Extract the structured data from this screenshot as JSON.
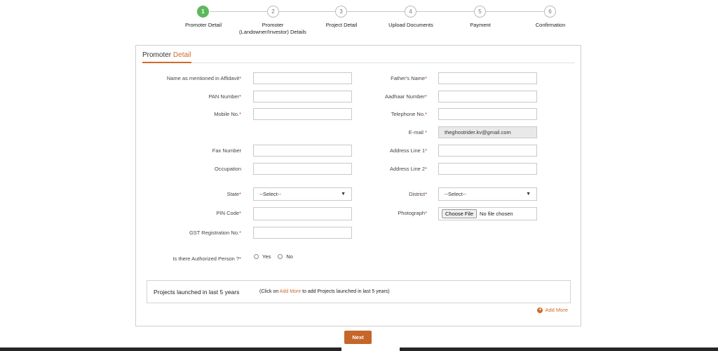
{
  "stepper": {
    "steps": [
      {
        "number": "1",
        "label": "Promoter Detail"
      },
      {
        "number": "2",
        "label": "Promoter",
        "label2": "(Landowner/Investor) Details"
      },
      {
        "number": "3",
        "label": "Project Detail"
      },
      {
        "number": "4",
        "label": "Upload Documents"
      },
      {
        "number": "5",
        "label": "Payment"
      },
      {
        "number": "6",
        "label": "Confirmation"
      }
    ]
  },
  "form": {
    "title_main": "Promoter",
    "title_accent": "Detail",
    "required_mark": "*",
    "fields": {
      "name_affidavit": {
        "label": "Name as mentioned in Affidavit",
        "value": ""
      },
      "fathers_name": {
        "label": "Father's Name",
        "value": ""
      },
      "pan": {
        "label": "PAN Number",
        "value": ""
      },
      "aadhaar": {
        "label": "Aadhaar Number",
        "value": ""
      },
      "mobile": {
        "label": "Mobile No.",
        "value": ""
      },
      "telephone": {
        "label": "Telephone No.",
        "value": ""
      },
      "email": {
        "label": "E-mail",
        "value": "theghostrider.kv@gmail.com"
      },
      "fax": {
        "label": "Fax Number",
        "value": ""
      },
      "address1": {
        "label": "Address Line 1",
        "value": ""
      },
      "occupation": {
        "label": "Occupation",
        "value": ""
      },
      "address2": {
        "label": "Address Line 2",
        "value": ""
      },
      "state": {
        "label": "State",
        "value": "--Select--"
      },
      "district": {
        "label": "District",
        "value": "--Select--"
      },
      "pin": {
        "label": "PIN Code",
        "value": ""
      },
      "photograph": {
        "label": "Photograph",
        "button": "Choose File",
        "status": "No file chosen"
      },
      "gst": {
        "label": "GST Registration No.",
        "value": ""
      }
    },
    "authorized": {
      "label": "Is there Authorized Person ?",
      "yes": "Yes",
      "no": "No"
    },
    "projects": {
      "title": "Projects launched in last 5 years",
      "note_prefix": "(Click on",
      "note_link": "Add More",
      "note_suffix": "to add Projects launched in last 5 years)"
    },
    "add_more": "Add More",
    "next": "Next"
  },
  "colors": {
    "accent": "#d06a2a",
    "active_step": "#5cb85c",
    "required": "#c9302c"
  }
}
